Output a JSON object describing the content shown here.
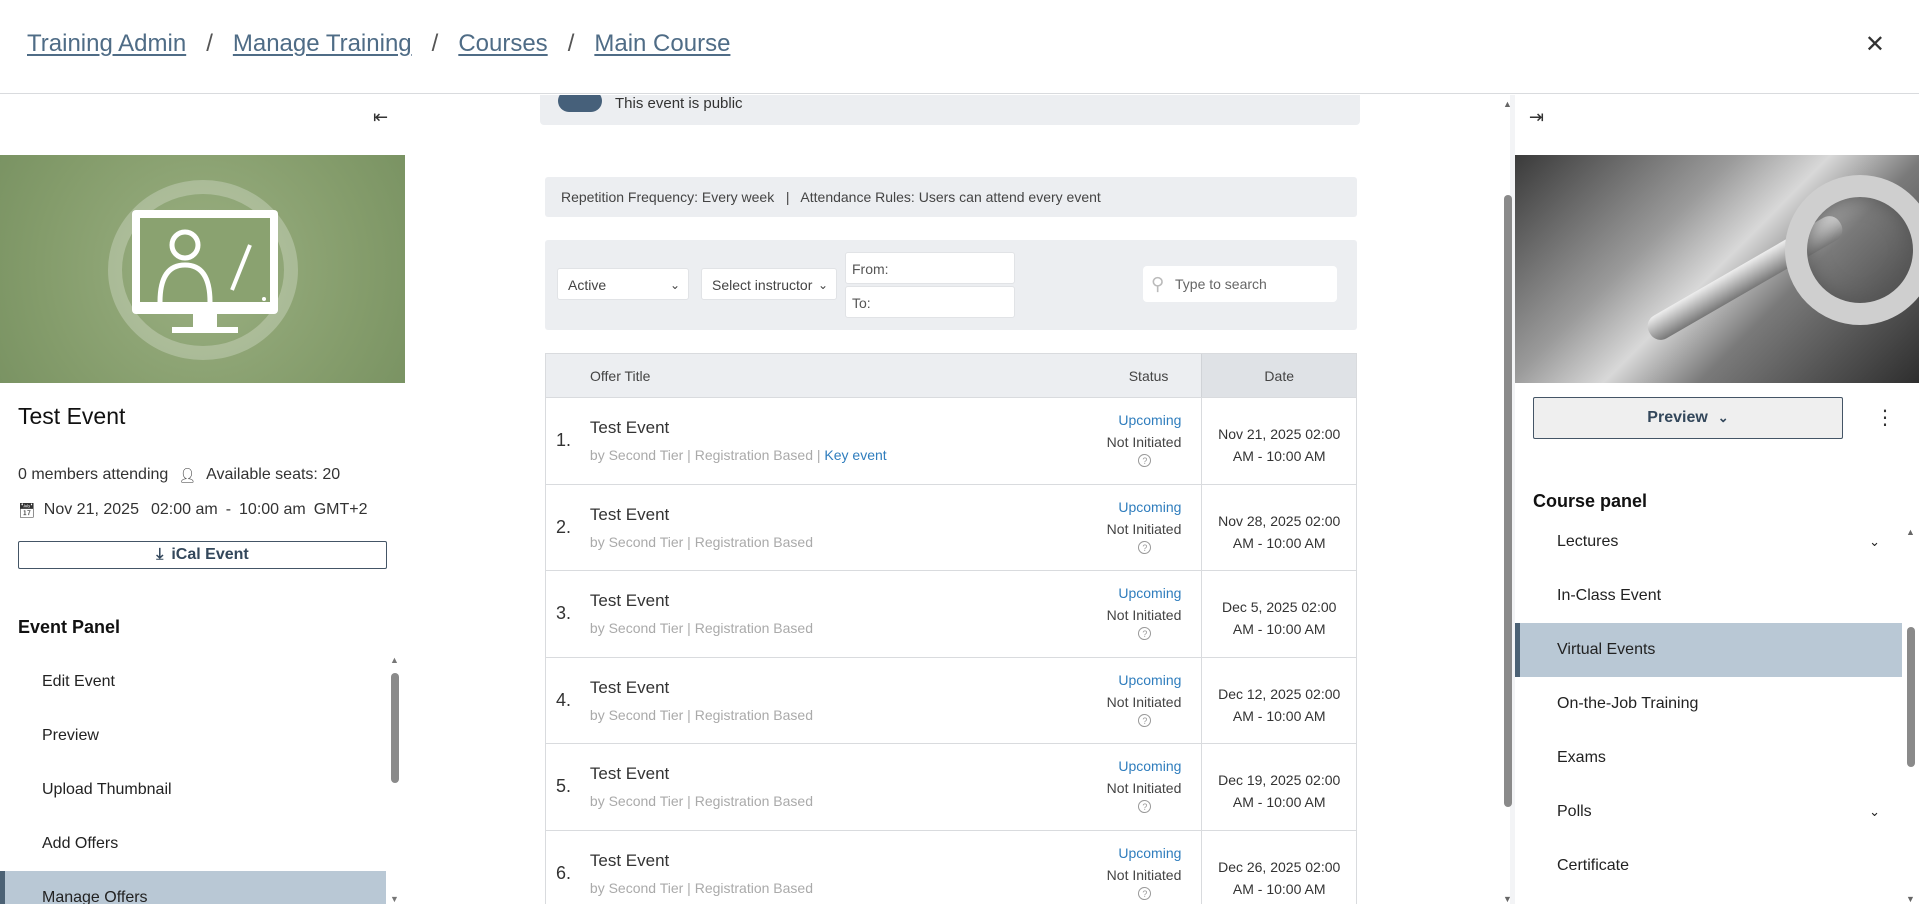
{
  "breadcrumb": [
    "Training Admin",
    "Manage Training",
    "Courses",
    "Main Course"
  ],
  "left": {
    "event_title": "Test Event",
    "members": "0 members attending",
    "seats": "Available seats: 20",
    "date": "Nov 21, 2025",
    "time_start": "02:00 am",
    "time_sep": "-",
    "time_end": "10:00 am",
    "timezone": "GMT+2",
    "ical_label": "iCal Event",
    "panel_heading": "Event Panel",
    "menu": [
      "Edit Event",
      "Preview",
      "Upload Thumbnail",
      "Add Offers",
      "Manage Offers"
    ]
  },
  "center": {
    "public_text": "This event is public",
    "rules_text": "Repetition Frequency: Every week   |   Attendance Rules: Users can attend every event",
    "filters": {
      "status_value": "Active",
      "instructor_value": "Select instructor",
      "from_label": "From:",
      "to_label": "To:",
      "search_placeholder": "Type to search"
    },
    "table": {
      "headers": {
        "title": "Offer Title",
        "status": "Status",
        "date": "Date"
      },
      "rows": [
        {
          "num": "1.",
          "title": "Test Event",
          "sub": "by Second Tier | Registration Based | ",
          "key": "Key event",
          "status": "Upcoming",
          "state": "Not Initiated",
          "date1": "Nov 21, 2025 02:00",
          "date2": "AM - 10:00 AM"
        },
        {
          "num": "2.",
          "title": "Test Event",
          "sub": "by Second Tier | Registration Based",
          "key": "",
          "status": "Upcoming",
          "state": "Not Initiated",
          "date1": "Nov 28, 2025 02:00",
          "date2": "AM - 10:00 AM"
        },
        {
          "num": "3.",
          "title": "Test Event",
          "sub": "by Second Tier | Registration Based",
          "key": "",
          "status": "Upcoming",
          "state": "Not Initiated",
          "date1": "Dec 5, 2025 02:00",
          "date2": "AM - 10:00 AM"
        },
        {
          "num": "4.",
          "title": "Test Event",
          "sub": "by Second Tier | Registration Based",
          "key": "",
          "status": "Upcoming",
          "state": "Not Initiated",
          "date1": "Dec 12, 2025 02:00",
          "date2": "AM - 10:00 AM"
        },
        {
          "num": "5.",
          "title": "Test Event",
          "sub": "by Second Tier | Registration Based",
          "key": "",
          "status": "Upcoming",
          "state": "Not Initiated",
          "date1": "Dec 19, 2025 02:00",
          "date2": "AM - 10:00 AM"
        },
        {
          "num": "6.",
          "title": "Test Event",
          "sub": "by Second Tier | Registration Based",
          "key": "",
          "status": "Upcoming",
          "state": "Not Initiated",
          "date1": "Dec 26, 2025 02:00",
          "date2": "AM - 10:00 AM"
        }
      ]
    }
  },
  "right": {
    "preview_label": "Preview",
    "course_heading": "Course panel",
    "menu": [
      "Lectures",
      "In-Class Event",
      "Virtual Events",
      "On-the-Job Training",
      "Exams",
      "Polls",
      "Certificate"
    ]
  },
  "colors": {
    "accent": "#4f6c86",
    "active_bg": "#b9c8d5",
    "link_blue": "#2f7dbd"
  }
}
